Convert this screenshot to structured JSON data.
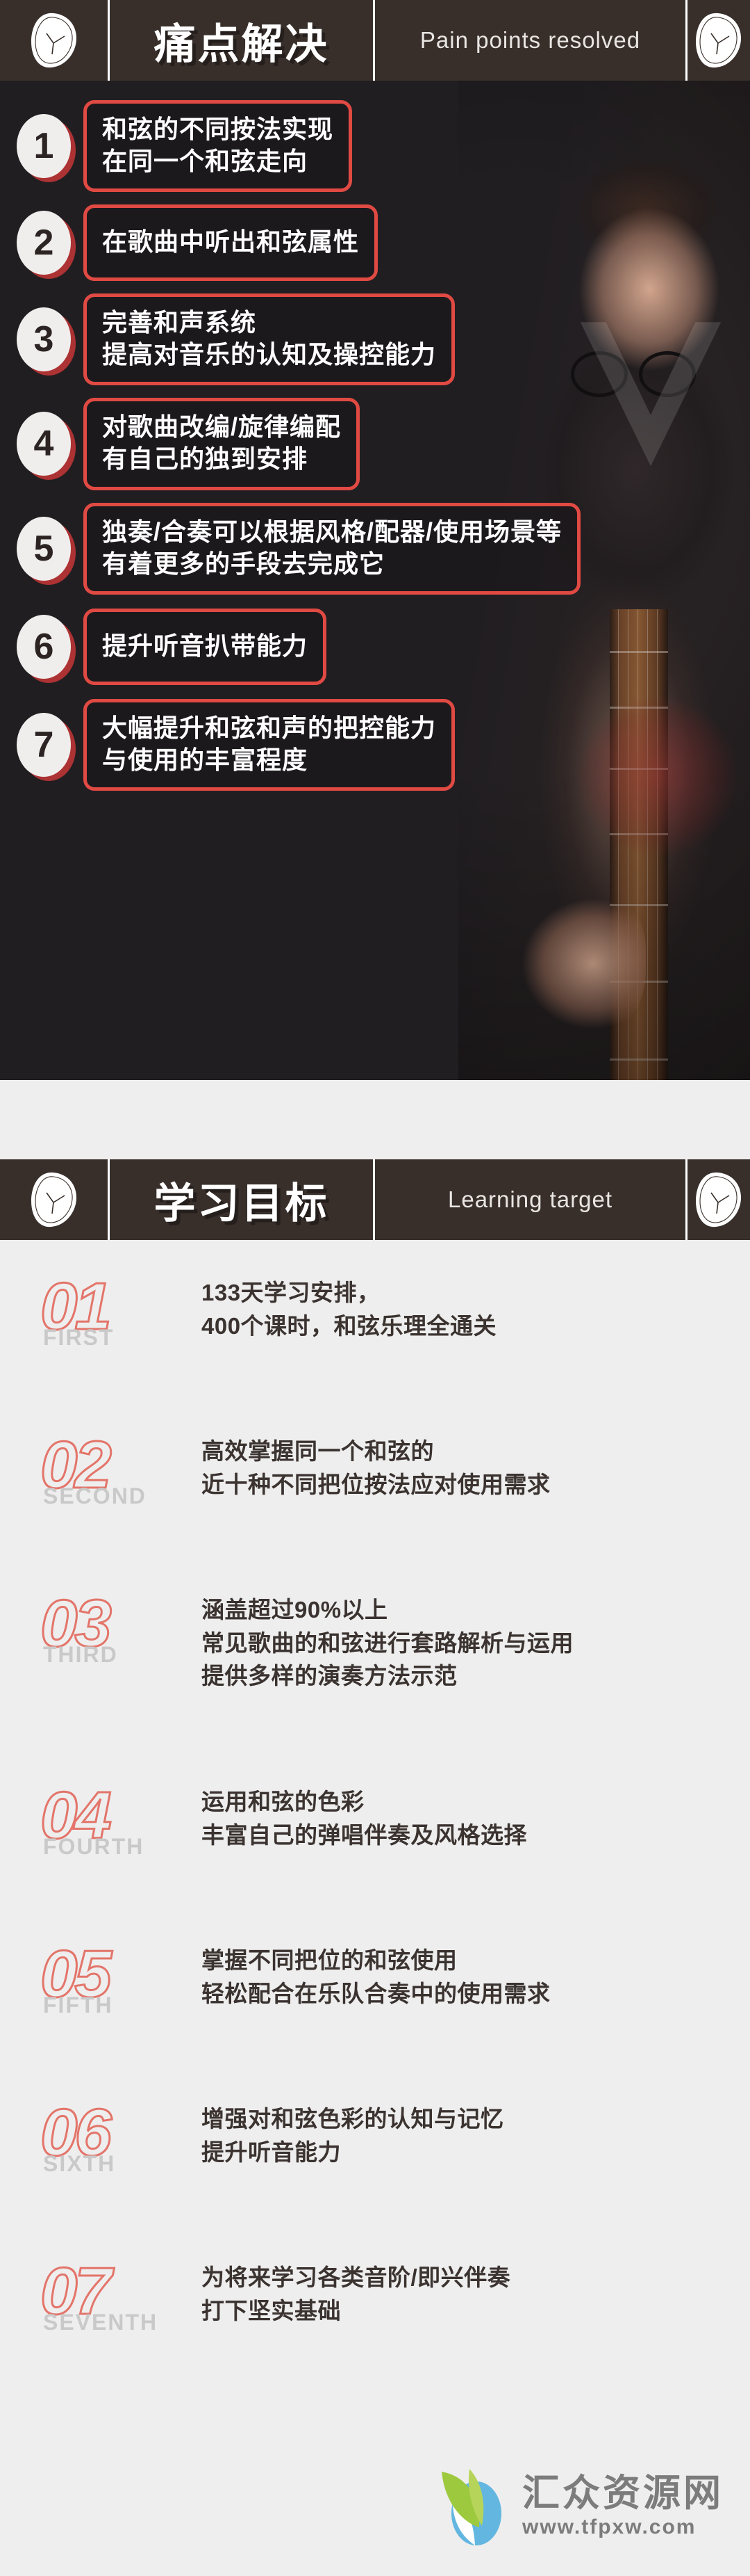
{
  "colors": {
    "header_bar_bg": "#382f2b",
    "dark_section_bg": "#211e22",
    "light_section_bg": "#eeeeee",
    "accent_red": "#e04a43",
    "outline_number_red": "#e3756a",
    "muted_gray": "#c9c9c9",
    "body_text_dark": "#3b3330",
    "watermark_gray": "#7c7c7c"
  },
  "sections": [
    {
      "id": "pain-points",
      "header": {
        "title_zh": "痛点解决",
        "title_en": "Pain points resolved",
        "left_icon": "guitar-pick-badge-icon",
        "right_icon": "guitar-pick-badge-icon"
      },
      "items": [
        {
          "number": "1",
          "lines": [
            "和弦的不同按法实现",
            "在同一个和弦走向"
          ]
        },
        {
          "number": "2",
          "lines": [
            "在歌曲中听出和弦属性"
          ]
        },
        {
          "number": "3",
          "lines": [
            "完善和声系统",
            "提高对音乐的认知及操控能力"
          ]
        },
        {
          "number": "4",
          "lines": [
            "对歌曲改编/旋律编配",
            "有自己的独到安排"
          ]
        },
        {
          "number": "5",
          "lines": [
            "独奏/合奏可以根据风格/配器/使用场景等",
            "有着更多的手段去完成它"
          ]
        },
        {
          "number": "6",
          "lines": [
            "提升听音扒带能力"
          ]
        },
        {
          "number": "7",
          "lines": [
            "大幅提升和弦和声的把控能力",
            "与使用的丰富程度"
          ]
        }
      ]
    },
    {
      "id": "learning-target",
      "header": {
        "title_zh": "学习目标",
        "title_en": "Learning target",
        "left_icon": "guitar-pick-badge-icon",
        "right_icon": "guitar-pick-badge-icon"
      },
      "items": [
        {
          "number": "01",
          "word": "FIRST",
          "lines": [
            "133天学习安排，",
            "400个课时，和弦乐理全通关"
          ]
        },
        {
          "number": "02",
          "word": "SECOND",
          "lines": [
            "高效掌握同一个和弦的",
            "近十种不同把位按法应对使用需求"
          ]
        },
        {
          "number": "03",
          "word": "THIRD",
          "lines": [
            "涵盖超过90%以上",
            "常见歌曲的和弦进行套路解析与运用",
            "提供多样的演奏方法示范"
          ]
        },
        {
          "number": "04",
          "word": "FOURTH",
          "lines": [
            "运用和弦的色彩",
            "丰富自己的弹唱伴奏及风格选择"
          ]
        },
        {
          "number": "05",
          "word": "FIFTH",
          "lines": [
            "掌握不同把位的和弦使用",
            "轻松配合在乐队合奏中的使用需求"
          ]
        },
        {
          "number": "06",
          "word": "SIXTH",
          "lines": [
            "增强对和弦色彩的认知与记忆",
            "提升听音能力"
          ]
        },
        {
          "number": "07",
          "word": "SEVENTH",
          "lines": [
            "为将来学习各类音阶/即兴伴奏",
            "打下坚实基础"
          ]
        }
      ]
    }
  ],
  "watermark": {
    "logo_icon": "leaf-v-logo-icon",
    "brand_cn": "汇众资源网",
    "url": "www.tfpxw.com"
  }
}
